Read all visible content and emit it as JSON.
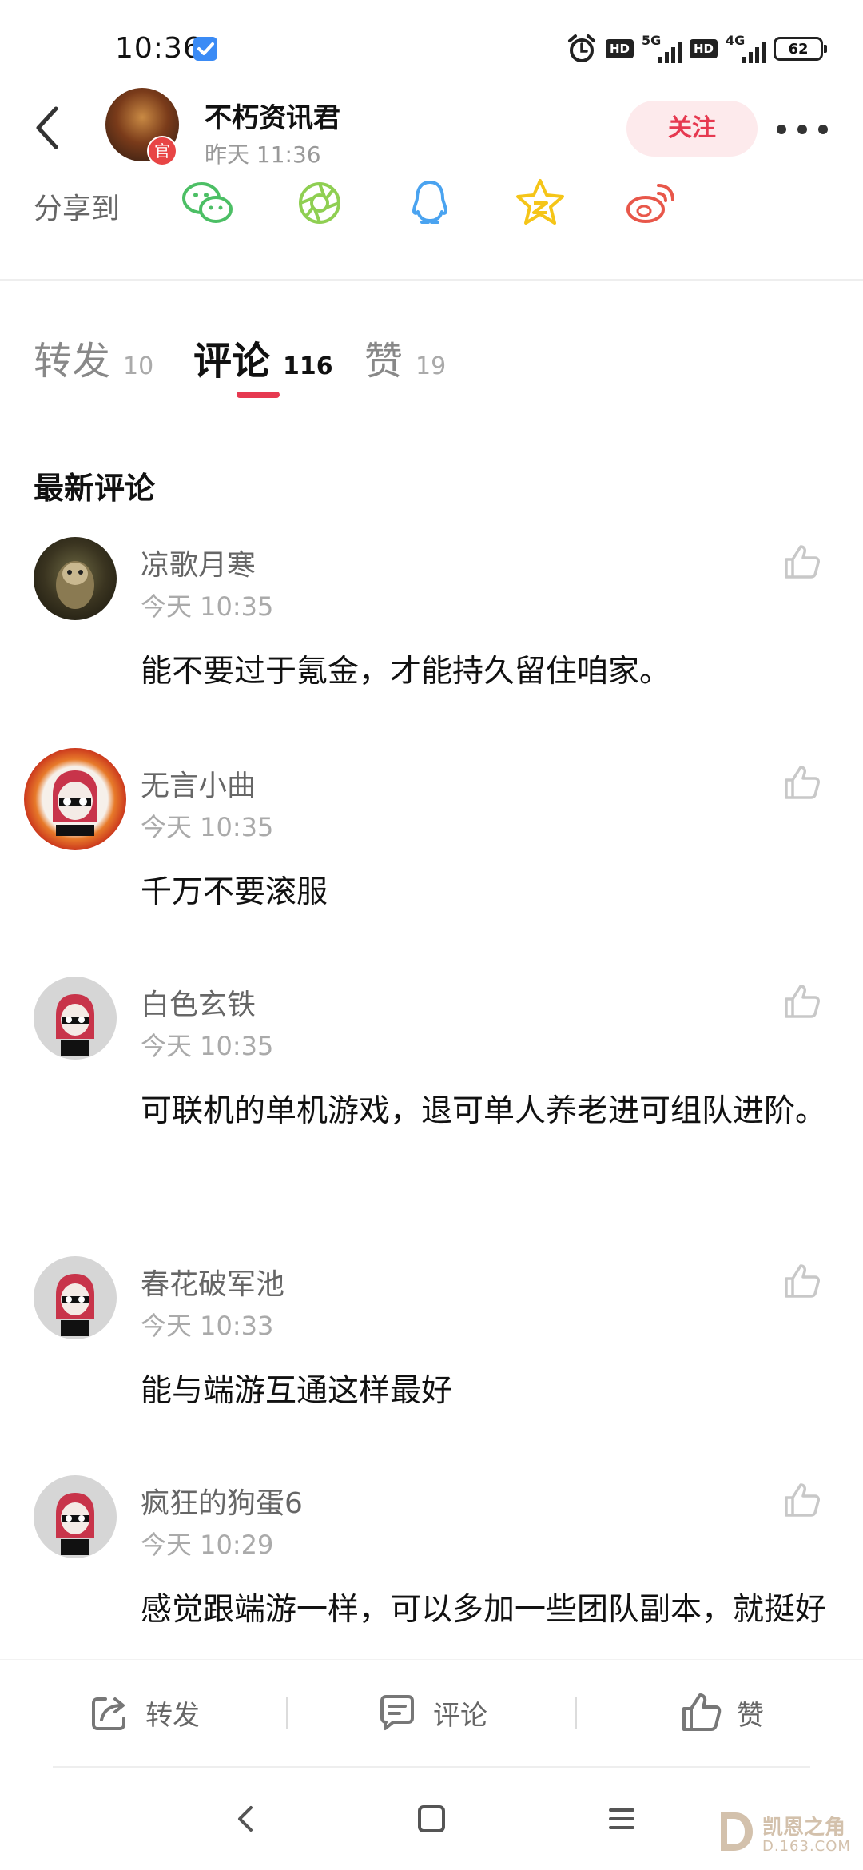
{
  "status": {
    "time": "10:36",
    "hd1": "HD",
    "net1": "5G",
    "hd2": "HD",
    "net2": "4G",
    "battery": "62"
  },
  "header": {
    "author_name": "不朽资讯君",
    "official_badge": "官",
    "post_time": "昨天 11:36",
    "follow_label": "关注"
  },
  "share": {
    "label": "分享到",
    "targets": [
      "wechat-icon",
      "moments-icon",
      "qq-icon",
      "qzone-icon",
      "weibo-icon"
    ]
  },
  "tabs": [
    {
      "label": "转发",
      "count": "10",
      "active": false
    },
    {
      "label": "评论",
      "count": "116",
      "active": true
    },
    {
      "label": "赞",
      "count": "19",
      "active": false
    }
  ],
  "section_title": "最新评论",
  "comments": [
    {
      "name": "凉歌月寒",
      "time": "今天 10:35",
      "text": "能不要过于氪金，才能持久留住咱家。"
    },
    {
      "name": "无言小曲",
      "time": "今天 10:35",
      "text": "千万不要滚服"
    },
    {
      "name": "白色玄铁",
      "time": "今天 10:35",
      "text": "可联机的单机游戏，退可单人养老进可组队进阶。"
    },
    {
      "name": "春花破军池",
      "time": "今天 10:33",
      "text": "能与端游互通这样最好"
    },
    {
      "name": "疯狂的狗蛋6",
      "time": "今天 10:29",
      "text": "感觉跟端游一样，可以多加一些团队副本，就挺好"
    }
  ],
  "action_bar": {
    "repost": "转发",
    "comment": "评论",
    "like": "赞"
  },
  "watermark": {
    "title": "凯恩之角",
    "sub": "D.163.COM"
  },
  "colors": {
    "accent": "#e63950",
    "follow_bg": "#fdeaec",
    "wechat": "#4cbf65",
    "moments": "#8fcf52",
    "qq": "#4aa3f0",
    "qzone": "#f5c518",
    "weibo": "#e8574a"
  }
}
